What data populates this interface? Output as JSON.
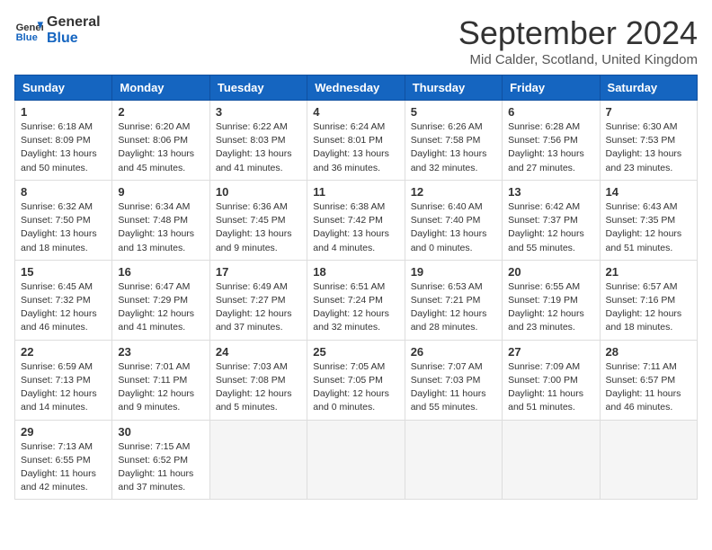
{
  "logo": {
    "line1": "General",
    "line2": "Blue"
  },
  "title": "September 2024",
  "location": "Mid Calder, Scotland, United Kingdom",
  "days_of_week": [
    "Sunday",
    "Monday",
    "Tuesday",
    "Wednesday",
    "Thursday",
    "Friday",
    "Saturday"
  ],
  "weeks": [
    [
      {
        "day": 1,
        "info": "Sunrise: 6:18 AM\nSunset: 8:09 PM\nDaylight: 13 hours\nand 50 minutes."
      },
      {
        "day": 2,
        "info": "Sunrise: 6:20 AM\nSunset: 8:06 PM\nDaylight: 13 hours\nand 45 minutes."
      },
      {
        "day": 3,
        "info": "Sunrise: 6:22 AM\nSunset: 8:03 PM\nDaylight: 13 hours\nand 41 minutes."
      },
      {
        "day": 4,
        "info": "Sunrise: 6:24 AM\nSunset: 8:01 PM\nDaylight: 13 hours\nand 36 minutes."
      },
      {
        "day": 5,
        "info": "Sunrise: 6:26 AM\nSunset: 7:58 PM\nDaylight: 13 hours\nand 32 minutes."
      },
      {
        "day": 6,
        "info": "Sunrise: 6:28 AM\nSunset: 7:56 PM\nDaylight: 13 hours\nand 27 minutes."
      },
      {
        "day": 7,
        "info": "Sunrise: 6:30 AM\nSunset: 7:53 PM\nDaylight: 13 hours\nand 23 minutes."
      }
    ],
    [
      {
        "day": 8,
        "info": "Sunrise: 6:32 AM\nSunset: 7:50 PM\nDaylight: 13 hours\nand 18 minutes."
      },
      {
        "day": 9,
        "info": "Sunrise: 6:34 AM\nSunset: 7:48 PM\nDaylight: 13 hours\nand 13 minutes."
      },
      {
        "day": 10,
        "info": "Sunrise: 6:36 AM\nSunset: 7:45 PM\nDaylight: 13 hours\nand 9 minutes."
      },
      {
        "day": 11,
        "info": "Sunrise: 6:38 AM\nSunset: 7:42 PM\nDaylight: 13 hours\nand 4 minutes."
      },
      {
        "day": 12,
        "info": "Sunrise: 6:40 AM\nSunset: 7:40 PM\nDaylight: 13 hours\nand 0 minutes."
      },
      {
        "day": 13,
        "info": "Sunrise: 6:42 AM\nSunset: 7:37 PM\nDaylight: 12 hours\nand 55 minutes."
      },
      {
        "day": 14,
        "info": "Sunrise: 6:43 AM\nSunset: 7:35 PM\nDaylight: 12 hours\nand 51 minutes."
      }
    ],
    [
      {
        "day": 15,
        "info": "Sunrise: 6:45 AM\nSunset: 7:32 PM\nDaylight: 12 hours\nand 46 minutes."
      },
      {
        "day": 16,
        "info": "Sunrise: 6:47 AM\nSunset: 7:29 PM\nDaylight: 12 hours\nand 41 minutes."
      },
      {
        "day": 17,
        "info": "Sunrise: 6:49 AM\nSunset: 7:27 PM\nDaylight: 12 hours\nand 37 minutes."
      },
      {
        "day": 18,
        "info": "Sunrise: 6:51 AM\nSunset: 7:24 PM\nDaylight: 12 hours\nand 32 minutes."
      },
      {
        "day": 19,
        "info": "Sunrise: 6:53 AM\nSunset: 7:21 PM\nDaylight: 12 hours\nand 28 minutes."
      },
      {
        "day": 20,
        "info": "Sunrise: 6:55 AM\nSunset: 7:19 PM\nDaylight: 12 hours\nand 23 minutes."
      },
      {
        "day": 21,
        "info": "Sunrise: 6:57 AM\nSunset: 7:16 PM\nDaylight: 12 hours\nand 18 minutes."
      }
    ],
    [
      {
        "day": 22,
        "info": "Sunrise: 6:59 AM\nSunset: 7:13 PM\nDaylight: 12 hours\nand 14 minutes."
      },
      {
        "day": 23,
        "info": "Sunrise: 7:01 AM\nSunset: 7:11 PM\nDaylight: 12 hours\nand 9 minutes."
      },
      {
        "day": 24,
        "info": "Sunrise: 7:03 AM\nSunset: 7:08 PM\nDaylight: 12 hours\nand 5 minutes."
      },
      {
        "day": 25,
        "info": "Sunrise: 7:05 AM\nSunset: 7:05 PM\nDaylight: 12 hours\nand 0 minutes."
      },
      {
        "day": 26,
        "info": "Sunrise: 7:07 AM\nSunset: 7:03 PM\nDaylight: 11 hours\nand 55 minutes."
      },
      {
        "day": 27,
        "info": "Sunrise: 7:09 AM\nSunset: 7:00 PM\nDaylight: 11 hours\nand 51 minutes."
      },
      {
        "day": 28,
        "info": "Sunrise: 7:11 AM\nSunset: 6:57 PM\nDaylight: 11 hours\nand 46 minutes."
      }
    ],
    [
      {
        "day": 29,
        "info": "Sunrise: 7:13 AM\nSunset: 6:55 PM\nDaylight: 11 hours\nand 42 minutes."
      },
      {
        "day": 30,
        "info": "Sunrise: 7:15 AM\nSunset: 6:52 PM\nDaylight: 11 hours\nand 37 minutes."
      },
      null,
      null,
      null,
      null,
      null
    ]
  ]
}
